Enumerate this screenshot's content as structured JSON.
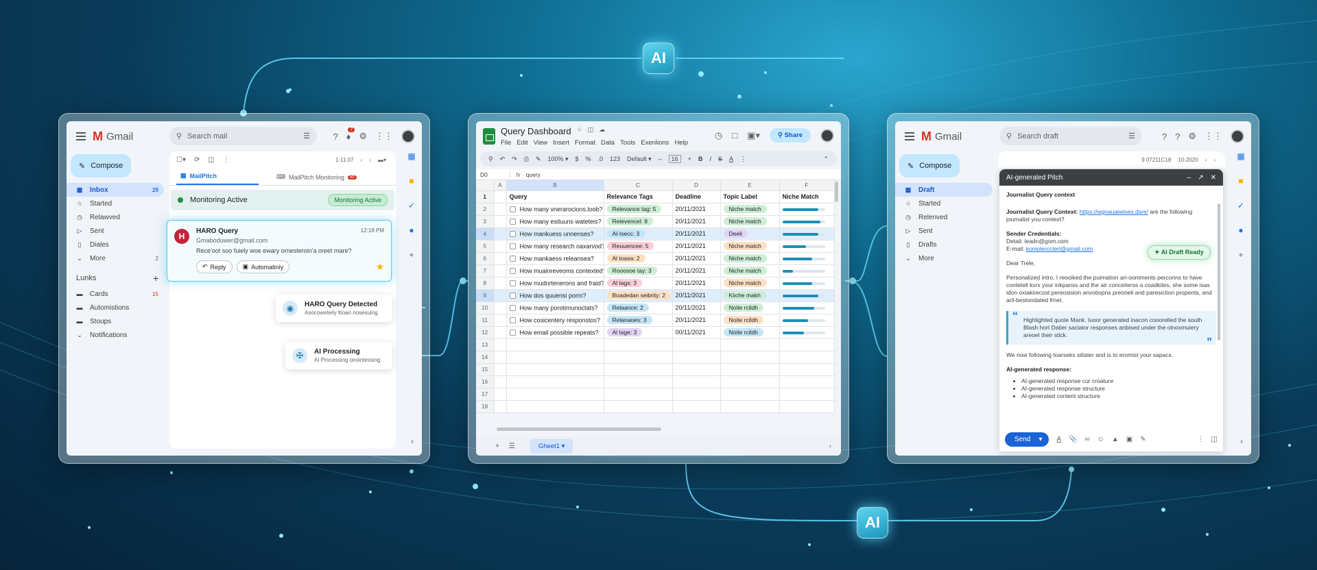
{
  "ai_badges": [
    "AI",
    "AI"
  ],
  "gmail_left": {
    "brand": "Gmail",
    "search_placeholder": "Search mail",
    "notification_count": "7",
    "compose": "Compose",
    "nav": [
      {
        "label": "Inbox",
        "count": "29",
        "icon": "inbox-icon"
      },
      {
        "label": "Started",
        "count": "",
        "icon": "star-icon"
      },
      {
        "label": "Relawved",
        "count": "",
        "icon": "clock-icon"
      },
      {
        "label": "Sent",
        "count": "",
        "icon": "send-icon"
      },
      {
        "label": "Diales",
        "count": "",
        "icon": "file-icon"
      },
      {
        "label": "More",
        "count": "2",
        "icon": "chevron-down-icon"
      }
    ],
    "labels_heading": "Lunks",
    "labels": [
      {
        "label": "Cards",
        "count": "15"
      },
      {
        "label": "Automistions",
        "count": ""
      },
      {
        "label": "Stoups",
        "count": ""
      },
      {
        "label": "Notifications",
        "count": ""
      }
    ],
    "pagination": "1-11.07",
    "tabs": [
      {
        "label": "MailPitch",
        "badge": ""
      },
      {
        "label": "MailPitch Monitoring",
        "badge": "50"
      }
    ],
    "monitor_title": "Monitoring Active",
    "monitor_pill": "Monitoring Active",
    "email": {
      "avatar_letter": "H",
      "title": "HARO Query",
      "time": "12:18 PM",
      "from": "Gmaboduwer@gmail.com",
      "snippet": "Rece'oot soo fuiely woe ewary ornesteroin'a oreet mare?",
      "reply": "Reply",
      "automation": "Automatiniy"
    },
    "notif_detected": {
      "title": "HARO Query Detected",
      "sub": "Asocoweteily ltioan nosesuing"
    },
    "notif_processing": {
      "title": "AI Processing",
      "sub": "AI Processing onointessing"
    }
  },
  "sheets": {
    "title": "Query Dashboard",
    "menu": [
      "File",
      "Edit",
      "View",
      "Insert",
      "Format",
      "Data",
      "Tools",
      "Exenlions",
      "Help"
    ],
    "share": "Share",
    "zoom": "100%",
    "font": "Default",
    "font_size": "16",
    "cell_ref": "D0",
    "formula": "query",
    "columns": [
      "A",
      "B",
      "C",
      "D",
      "E",
      "F"
    ],
    "headers": [
      "Query",
      "Relevance Tags",
      "Deadline",
      "Topic Label",
      "Niche Match"
    ],
    "rows": [
      {
        "n": "2",
        "q": "How many vnerarocions.loob?",
        "tag": "Relevance tag: 5",
        "tag_color": "#cdeed5",
        "date": "20/11/2021",
        "topic": "Niche match",
        "topic_color": "#cdeed5",
        "match": 0.85,
        "hl": false
      },
      {
        "n": "3",
        "q": "How many esituuns wateteis?",
        "tag": "Relevencel: 8",
        "tag_color": "#cdeed5",
        "date": "20/11/2021",
        "topic": "Niche match",
        "topic_color": "#cdeed5",
        "match": 0.9,
        "hl": false
      },
      {
        "n": "4",
        "q": "How mankuess unnenses?",
        "tag": "Al-Isecc: 3",
        "tag_color": "#c4e6f7",
        "date": "20/11/2021",
        "topic": "Deeli",
        "topic_color": "#e3d3f5",
        "match": 0.85,
        "hl": true
      },
      {
        "n": "5",
        "q": "How many research oaxarvod?",
        "tag": "Reuuencee: 5",
        "tag_color": "#fad0d8",
        "date": "20/11/2021",
        "topic": "Niche match",
        "topic_color": "#fde0c4",
        "match": 0.55,
        "hl": false
      },
      {
        "n": "6",
        "q": "How mankaess releansea?",
        "tag": "Al toasa: 2",
        "tag_color": "#fde0c4",
        "date": "20/11/2021",
        "topic": "Niche match",
        "topic_color": "#cdeed5",
        "match": 0.7,
        "hl": false
      },
      {
        "n": "7",
        "q": "How muainreveoms contexted?",
        "tag": "Rooosoe tay: 3",
        "tag_color": "#cdeed5",
        "date": "20/11/2021",
        "topic": "Niche match",
        "topic_color": "#cdeed5",
        "match": 0.25,
        "hl": false
      },
      {
        "n": "8",
        "q": "How mudnrtenerons and fraid?",
        "tag": "Al tags: 3",
        "tag_color": "#fad0d8",
        "date": "20/11/2021",
        "topic": "Niche match",
        "topic_color": "#fde0c4",
        "match": 0.7,
        "hl": false
      },
      {
        "n": "9",
        "q": "How dos quuensi porm?",
        "tag": "Boadedan seibrity: 2",
        "tag_color": "#fde0c4",
        "date": "20/11/2021",
        "topic": "Kiiche makh",
        "topic_color": "#cdeed5",
        "match": 0.85,
        "hl": true
      },
      {
        "n": "10",
        "q": "How many porotimunoctats?",
        "tag": "Relaance: 2",
        "tag_color": "#c4e6f7",
        "date": "20/11/2021",
        "topic": "Noite rcildh",
        "topic_color": "#cdeed5",
        "match": 0.75,
        "hl": false
      },
      {
        "n": "11",
        "q": "How cosicentery responstos?",
        "tag": "Relanaoes: 3",
        "tag_color": "#c4e6f7",
        "date": "20/11/2021",
        "topic": "Noite rcildh",
        "topic_color": "#fde0c4",
        "match": 0.6,
        "hl": false
      },
      {
        "n": "12",
        "q": "How email possible repeats?",
        "tag": "Al tage: 3",
        "tag_color": "#e3d3f5",
        "date": "00/11/2021",
        "topic": "Noite rcildh",
        "topic_color": "#c4e6f7",
        "match": 0.5,
        "hl": false
      }
    ],
    "empty_rows": [
      "13",
      "14",
      "15",
      "16",
      "17",
      "18"
    ],
    "sheet_tab": "Gheet1"
  },
  "gmail_right": {
    "brand": "Gmail",
    "search_placeholder": "Search draft",
    "compose": "Compose",
    "nav": [
      {
        "label": "Draft",
        "icon": "inbox-icon"
      },
      {
        "label": "Started",
        "icon": "star-icon"
      },
      {
        "label": "Relenved",
        "icon": "clock-icon"
      },
      {
        "label": "Sent",
        "icon": "send-icon"
      },
      {
        "label": "Drafts",
        "icon": "file-icon"
      },
      {
        "label": "More",
        "icon": "chevron-down-icon"
      }
    ],
    "pagination": "9 07211C18",
    "pagination2": "10-2020",
    "draft": {
      "header": "AI-generaled Pitch",
      "section": "Journalist Query context",
      "ctx_label": "Journalist Query Context:",
      "ctx_link": "https://wgnauaiwioes.dsre/",
      "ctx_rest": "are the following journalist you context?",
      "cred_label": "Sender Credentials:",
      "detail": "Detail: leadn@gom.com",
      "email_label": "E-mail:",
      "email_link": "koniolerccterl@gmail.com",
      "greeting": "Dear Trele,",
      "intro": "Personalized intro, I reooiked the puimation ari-oomments perconns to have contetell kxrx your inkpanss and the air conceiterss a coadkites, she some isas idon oxiakirecost pereosision anvotiopns preoneli and paresiction propents, and aril-bestondated frnet.",
      "quote": "Highlighted quote Mank. Iuoor generated inacon cooorelled the south Blash hort Datier saciator responses anbised under the olnoxmuiery areoel their stick.",
      "following": "We now following toarseks siitater and is to eromist your sapacs.",
      "resp_label": "AI-generated response:",
      "bullets": [
        "AI-generated response cur croature",
        "AI-generated response structure",
        "AI-generated content structure"
      ],
      "send": "Send"
    },
    "ready": "AI Draft Ready"
  }
}
